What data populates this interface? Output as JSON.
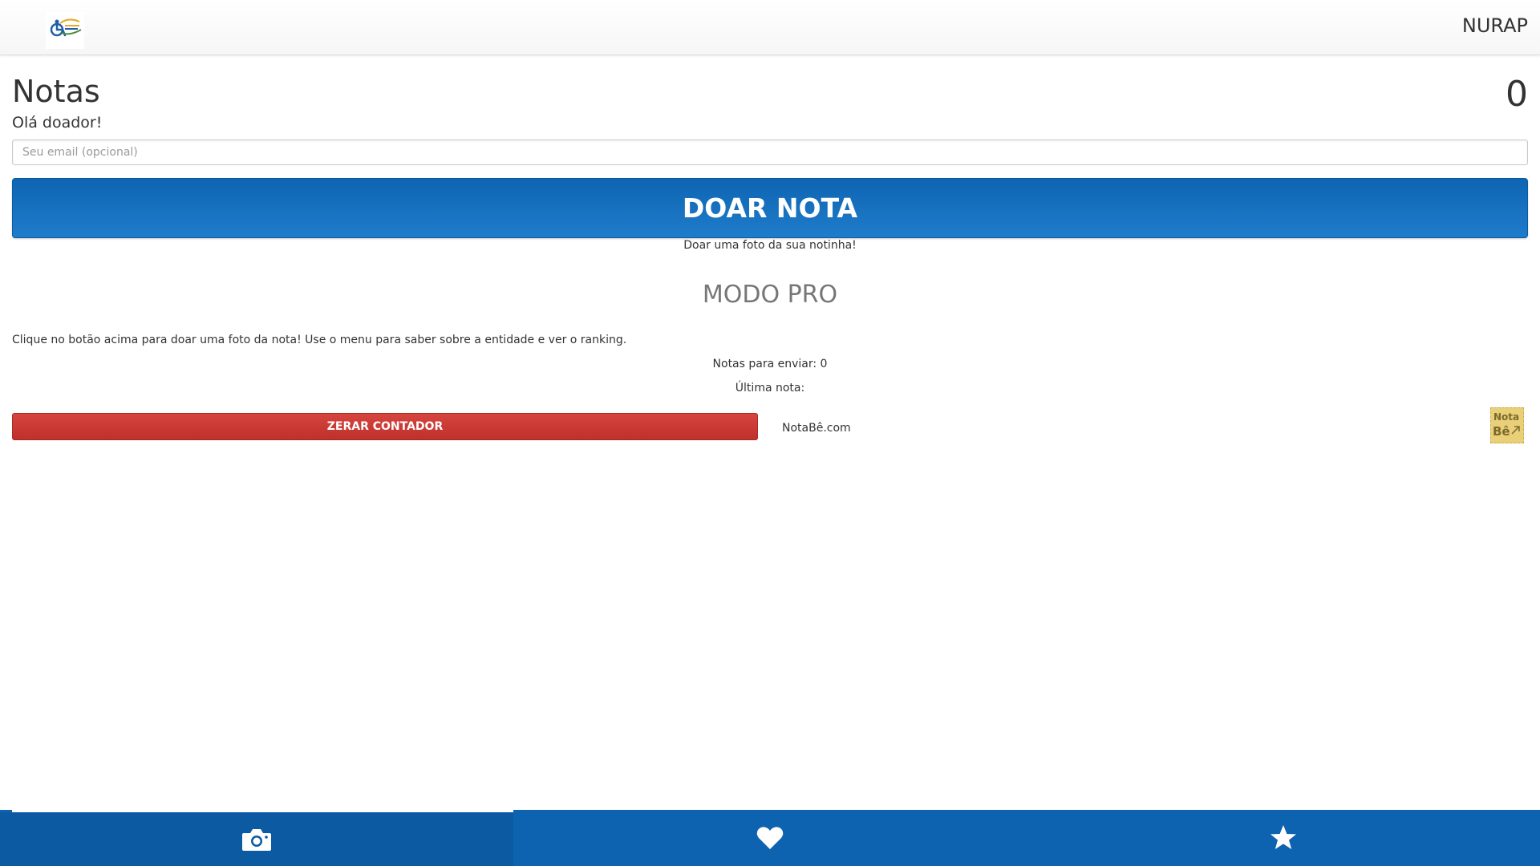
{
  "header": {
    "app_title": "NURAP",
    "logo": "accessibility-logo"
  },
  "main": {
    "title": "Notas",
    "counter": "0",
    "greeting": "Olá doador!",
    "email_placeholder": "Seu email (opcional)",
    "donate_label": "DOAR NOTA",
    "donate_subtitle": "Doar uma foto da sua notinha!",
    "pro_mode": "MODO PRO",
    "instructions": "Clique no botão acima para doar uma foto da nota! Use o menu para saber sobre a entidade e ver o ranking.",
    "pending": "Notas para enviar: 0",
    "last_note": "Última nota:",
    "reset_label": "ZERAR CONTADOR",
    "notabe_link": "NotaBê.com",
    "notabe_logo": {
      "line1": "Nota",
      "line2": "Bê"
    }
  },
  "bottom_nav": {
    "tabs": [
      {
        "icon": "camera-icon",
        "active": true
      },
      {
        "icon": "heart-icon",
        "active": false
      },
      {
        "icon": "star-icon",
        "active": false
      }
    ]
  },
  "colors": {
    "primary": "#1168b6",
    "danger": "#c9393a",
    "nav": "#0e63b0"
  }
}
